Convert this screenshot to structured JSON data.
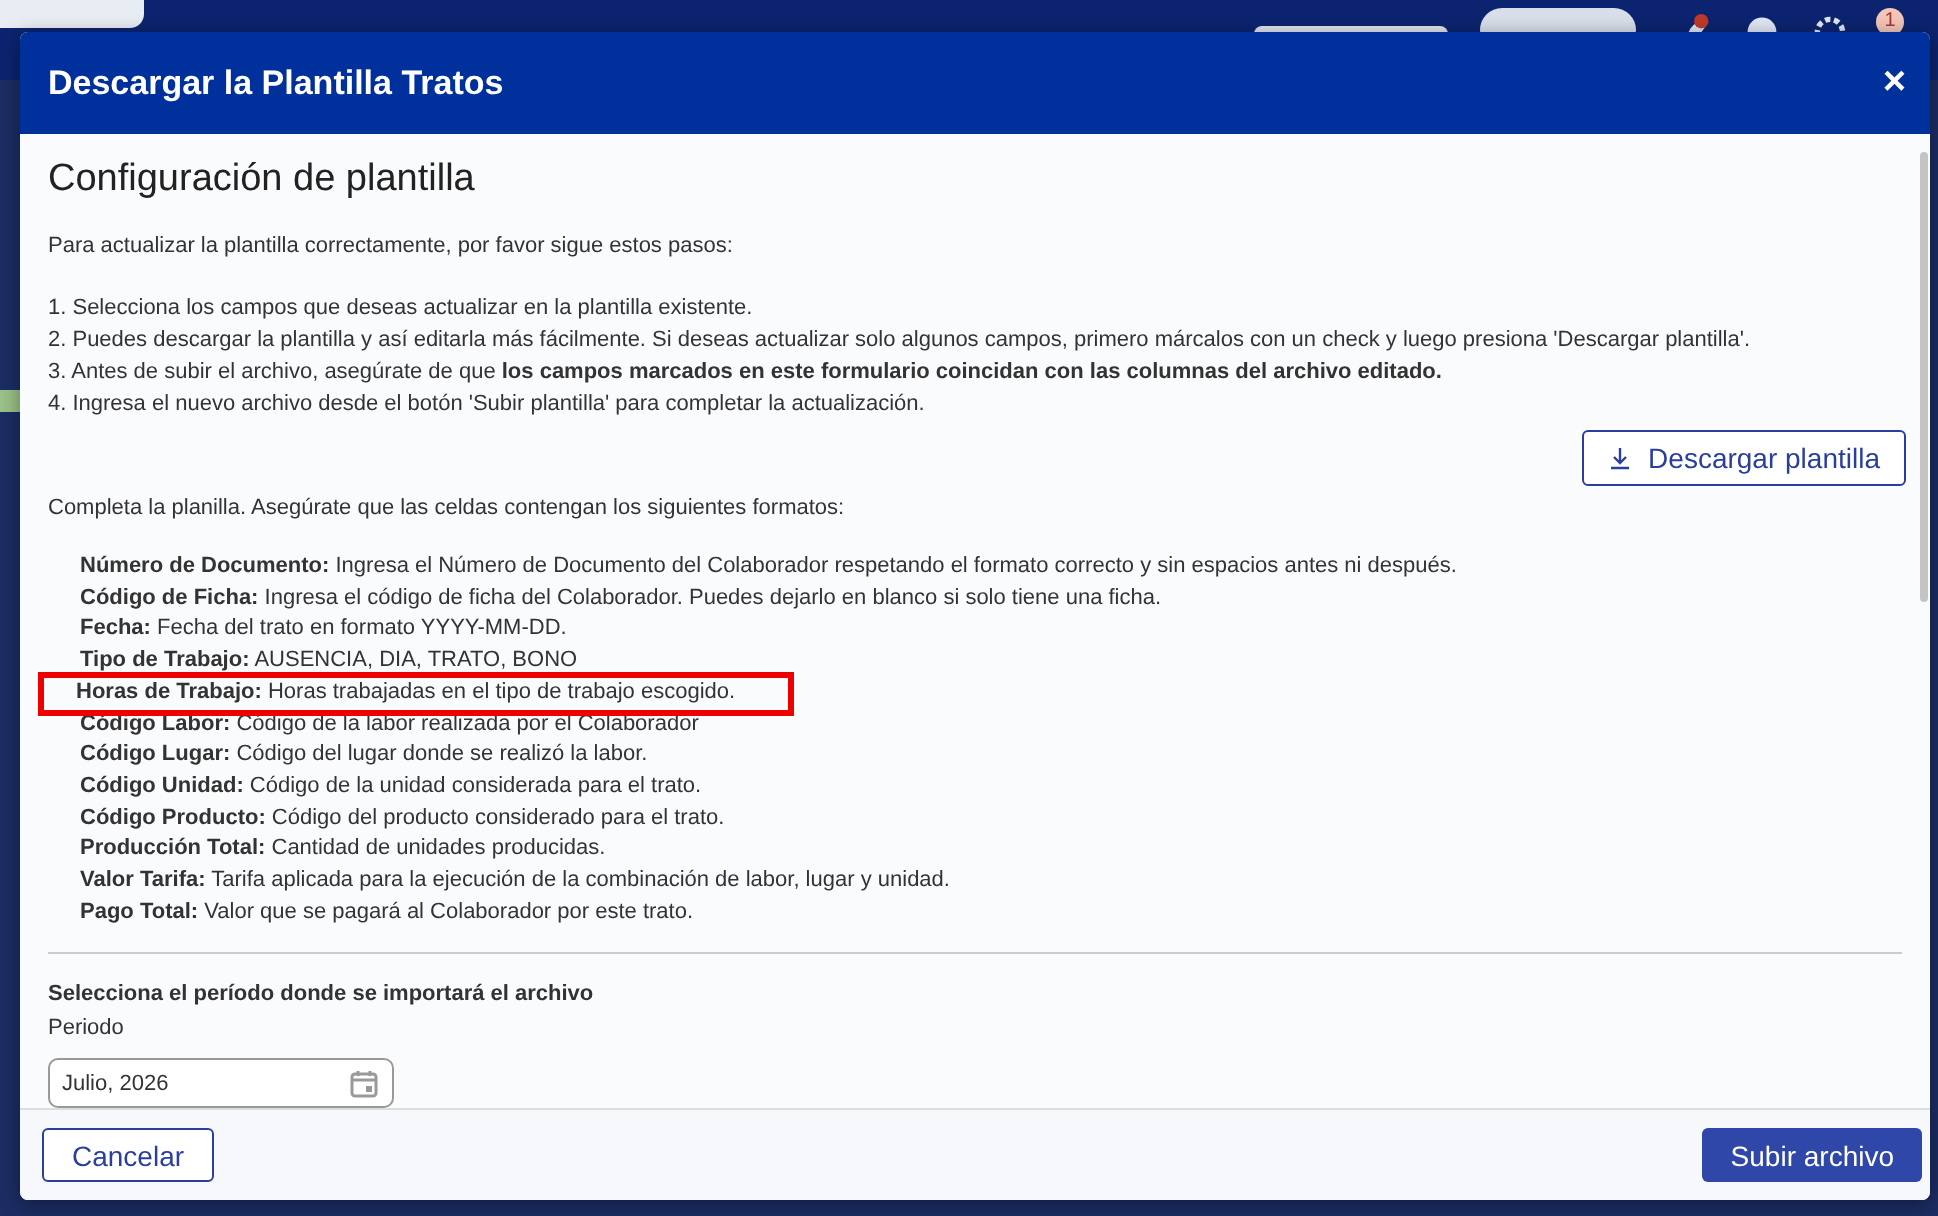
{
  "background": {
    "notification_count": "1"
  },
  "modal": {
    "title": "Descargar la Plantilla Tratos",
    "close": "×",
    "heading": "Configuración de plantilla",
    "intro": "Para actualizar la plantilla correctamente, por favor sigue estos pasos:",
    "steps": [
      "1. Selecciona los campos que deseas actualizar en la plantilla existente.",
      "2. Puedes descargar la plantilla y así editarla más fácilmente. Si deseas actualizar solo algunos campos, primero márcalos con un check y luego presiona 'Descargar plantilla'.",
      "3. Antes de subir el archivo, asegúrate de que **los campos marcados en este formulario coincidan con las columnas del archivo editado.**",
      "4. Ingresa el nuevo archivo desde el botón 'Subir plantilla' para completar la actualización."
    ],
    "download_button": "Descargar plantilla",
    "formats_intro": "Completa la planilla. Asegúrate que las celdas contengan los siguientes formatos:",
    "formats": [
      {
        "label": "Número de Documento:",
        "description": "Ingresa el Número de Documento del Colaborador respetando el formato correcto y sin espacios antes ni después.",
        "highlighted": false
      },
      {
        "label": "Código de Ficha:",
        "description": "Ingresa el código de ficha del Colaborador. Puedes dejarlo en blanco si solo tiene una ficha.",
        "highlighted": false
      },
      {
        "label": "Fecha:",
        "description": "Fecha del trato en formato YYYY-MM-DD.",
        "highlighted": false
      },
      {
        "label": "Tipo de Trabajo:",
        "description": "AUSENCIA, DIA, TRATO, BONO",
        "highlighted": false
      },
      {
        "label": "Horas de Trabajo:",
        "description": "Horas trabajadas en el tipo de trabajo escogido.",
        "highlighted": true
      },
      {
        "label": "Código Labor:",
        "description": "Código de la labor realizada por el Colaborador",
        "highlighted": false
      },
      {
        "label": "Código Lugar:",
        "description": "Código del lugar donde se realizó la labor.",
        "highlighted": false
      },
      {
        "label": "Código Unidad:",
        "description": "Código de la unidad considerada para el trato.",
        "highlighted": false
      },
      {
        "label": "Código Producto:",
        "description": "Código del producto considerado para el trato.",
        "highlighted": false
      },
      {
        "label": "Producción Total:",
        "description": "Cantidad de unidades producidas.",
        "highlighted": false
      },
      {
        "label": "Valor Tarifa:",
        "description": "Tarifa aplicada para la ejecución de la combinación de labor, lugar y unidad.",
        "highlighted": false
      },
      {
        "label": "Pago Total:",
        "description": "Valor que se pagará al Colaborador por este trato.",
        "highlighted": false
      }
    ],
    "period": {
      "title": "Selecciona el período donde se importará el archivo",
      "field_label": "Periodo",
      "value": "Julio, 2026"
    },
    "cancel_button": "Cancelar",
    "submit_button": "Subir archivo"
  }
}
